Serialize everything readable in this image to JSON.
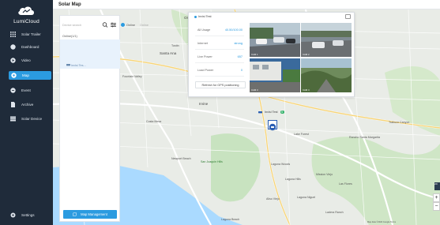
{
  "app": {
    "brand": "LumiCloud",
    "page_title": "Solar Map"
  },
  "sidebar": {
    "items": [
      {
        "label": "Solar Trailer",
        "icon": "grid-icon"
      },
      {
        "label": "Dashboard",
        "icon": "dashboard-icon"
      },
      {
        "label": "Video",
        "icon": "video-icon"
      },
      {
        "label": "Map",
        "icon": "map-icon",
        "active": true
      },
      {
        "label": "Event",
        "icon": "event-icon"
      },
      {
        "label": "Archive",
        "icon": "archive-icon"
      },
      {
        "label": "Solar Device",
        "icon": "solar-device-icon"
      }
    ],
    "settings_label": "Settings"
  },
  "panel": {
    "search_placeholder": "Device search",
    "list_header": "Online(1/1)",
    "device_name": "Invisi Tes...",
    "map_management_label": "Map Management"
  },
  "status": {
    "online_label": "Online",
    "offline_label": "Online",
    "online_color": "#2b9be0",
    "offline_color": "#9e9e9e"
  },
  "popup": {
    "title": "Invisi Test",
    "rows": [
      {
        "label": "All Usage",
        "value": "40.50/100.00"
      },
      {
        "label": "Internet",
        "value": "strong"
      },
      {
        "label": "Live Power",
        "value": "657"
      },
      {
        "label": "Load Power",
        "value": "0"
      }
    ],
    "refresh_label": "Refresh for GPS positioning",
    "cameras": [
      {
        "label": "CAM 1"
      },
      {
        "label": "CAM 2"
      },
      {
        "label": "CAM 3"
      },
      {
        "label": "CAM 4"
      }
    ]
  },
  "marker": {
    "label": "Invisi Test",
    "badge": "5"
  },
  "map": {
    "labels": [
      {
        "text": "Orange",
        "cls": "big"
      },
      {
        "text": "Santa Ana",
        "cls": "big"
      },
      {
        "text": "Irvine",
        "cls": "big"
      },
      {
        "text": "Costa Mesa",
        "cls": ""
      },
      {
        "text": "Newport Beach",
        "cls": ""
      },
      {
        "text": "Lake Forest",
        "cls": ""
      },
      {
        "text": "Laguna Woods",
        "cls": ""
      },
      {
        "text": "Laguna Hills",
        "cls": ""
      },
      {
        "text": "Mission Viejo",
        "cls": ""
      },
      {
        "text": "Aliso Viejo",
        "cls": ""
      },
      {
        "text": "Laguna Niguel",
        "cls": ""
      },
      {
        "text": "Ladera Ranch",
        "cls": ""
      },
      {
        "text": "Rancho Santa Margarita",
        "cls": ""
      },
      {
        "text": "Trabuco Canyon",
        "cls": ""
      },
      {
        "text": "Las Flores",
        "cls": ""
      },
      {
        "text": "San Joaquin Hills",
        "cls": ""
      },
      {
        "text": "Laguna Beach",
        "cls": ""
      },
      {
        "text": "Fountain Valley",
        "cls": ""
      },
      {
        "text": "Tustin",
        "cls": ""
      }
    ],
    "attribution": "Map data ©2024 Google  Terms"
  },
  "controls": {
    "zoom_in": "+",
    "zoom_out": "−",
    "layer": "2D"
  }
}
